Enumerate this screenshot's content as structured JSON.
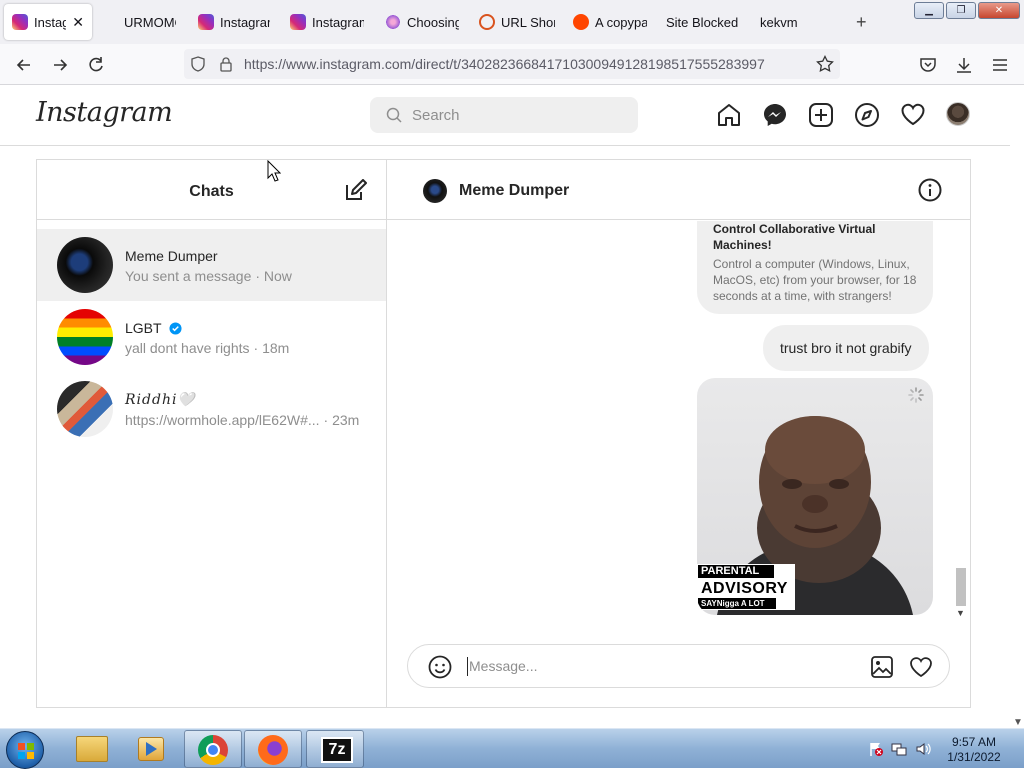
{
  "browser": {
    "tabs": [
      {
        "title": "Instagr",
        "active": true,
        "icon": "instagram-icon"
      },
      {
        "title": "URMOMC",
        "icon": "none"
      },
      {
        "title": "Instagram",
        "icon": "instagram-icon"
      },
      {
        "title": "Instagram",
        "icon": "instagram-icon"
      },
      {
        "title": "Choosing",
        "icon": "purple-flower-icon"
      },
      {
        "title": "URL Short",
        "icon": "url-shortener-icon"
      },
      {
        "title": "A copypa",
        "icon": "reddit-icon"
      },
      {
        "title": "Site Blocked",
        "icon": "none"
      },
      {
        "title": "kekvm",
        "icon": "none"
      }
    ],
    "close_tab_glyph": "✕",
    "new_tab_glyph": "+",
    "url": "https://www.instagram.com/direct/t/340282366841710300949128198517555283997"
  },
  "instagram": {
    "logo": "Instagram",
    "search_placeholder": "Search",
    "chats_title": "Chats",
    "chats": [
      {
        "name": "Meme Dumper",
        "preview": "You sent a message",
        "time": "· Now",
        "selected": true
      },
      {
        "name": "LGBT",
        "preview": "yall dont have rights",
        "time": "· 18m",
        "verified": true
      },
      {
        "name": "𝑅𝑖𝑑𝑑ℎ𝑖🤍",
        "preview": "https://wormhole.app/lE62W#...",
        "time": "· 23m"
      }
    ],
    "conversation": {
      "name": "Meme Dumper",
      "link_card_title": "Control Collaborative Virtual Machines!",
      "link_card_desc": "Control a computer (Windows, Linux, MacOS, etc) from your browser, for 18 seconds at a time, with strangers!",
      "message": "trust bro it not grabify",
      "image_sticker": {
        "line1": "PARENTAL",
        "line2": "ADVISORY",
        "line3": "SAYNigga A LOT"
      },
      "input_placeholder": "Message..."
    }
  },
  "taskbar": {
    "time": "9:57 AM",
    "date": "1/31/2022"
  },
  "colors": {
    "instagram_gradient": [
      "#feda75",
      "#d62976",
      "#962fbf",
      "#4f5bd5"
    ],
    "verified_blue": "#0095f6",
    "reddit_orange": "#ff4500"
  }
}
